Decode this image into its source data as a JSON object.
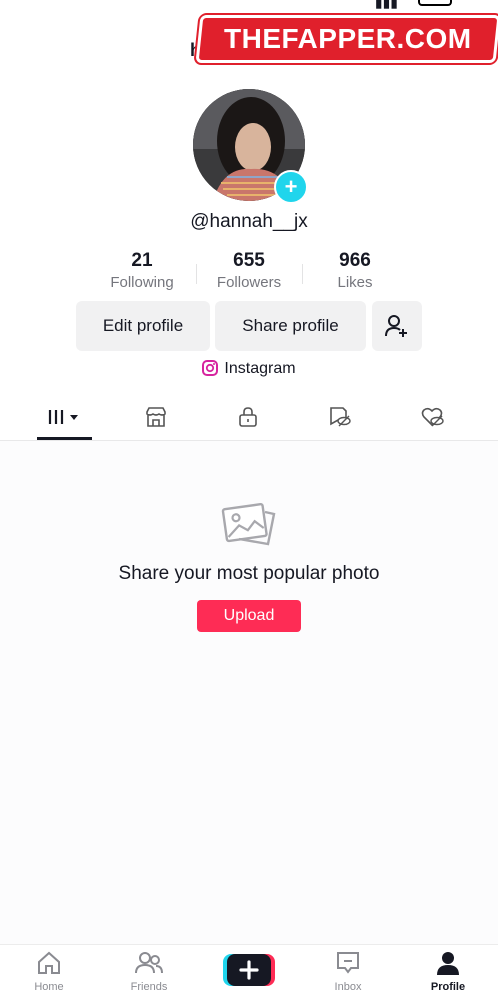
{
  "watermark": "THEFAPPER.COM",
  "header": {
    "name": "hannah"
  },
  "profile": {
    "username": "@hannah__jx",
    "stats": [
      {
        "value": "21",
        "label": "Following"
      },
      {
        "value": "655",
        "label": "Followers"
      },
      {
        "value": "966",
        "label": "Likes"
      }
    ],
    "buttons": {
      "edit": "Edit profile",
      "share": "Share profile"
    },
    "link": "Instagram"
  },
  "tabs": [
    "posts-grid",
    "shop",
    "private",
    "reposts",
    "liked"
  ],
  "empty_state": {
    "title": "Share your most popular photo",
    "upload_label": "Upload"
  },
  "nav": [
    {
      "label": "Home",
      "icon": "home-icon"
    },
    {
      "label": "Friends",
      "icon": "friends-icon"
    },
    {
      "label": "",
      "icon": "create-icon"
    },
    {
      "label": "Inbox",
      "icon": "inbox-icon"
    },
    {
      "label": "Profile",
      "icon": "profile-icon"
    }
  ],
  "colors": {
    "accent": "#fe2c55",
    "badge": "#20d5ec",
    "watermark": "#e0202c"
  }
}
